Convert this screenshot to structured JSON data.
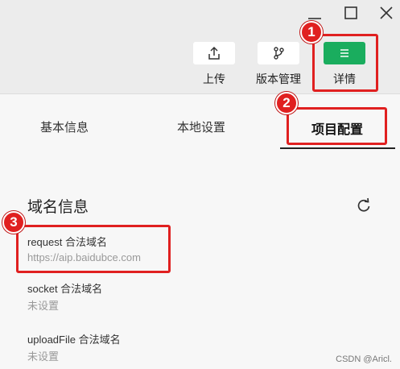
{
  "window": {
    "controls": [
      "minimize-icon",
      "maximize-icon",
      "close-icon"
    ]
  },
  "toolbar": {
    "upload_label": "上传",
    "version_label": "版本管理",
    "details_label": "详情"
  },
  "tabs": [
    {
      "label": "基本信息"
    },
    {
      "label": "本地设置"
    },
    {
      "label": "项目配置",
      "active": true
    }
  ],
  "domain_info": {
    "title": "域名信息",
    "fields": [
      {
        "label": "request 合法域名",
        "value": "https://aip.baidubce.com"
      },
      {
        "label": "socket 合法域名",
        "value": "未设置"
      },
      {
        "label": "uploadFile 合法域名",
        "value": "未设置"
      }
    ]
  },
  "annotations": {
    "badge1": "1",
    "badge2": "2",
    "badge3": "3",
    "color": "#e02020"
  },
  "colors": {
    "accent_green": "#1aad5e"
  },
  "watermark": "CSDN @Aricl."
}
